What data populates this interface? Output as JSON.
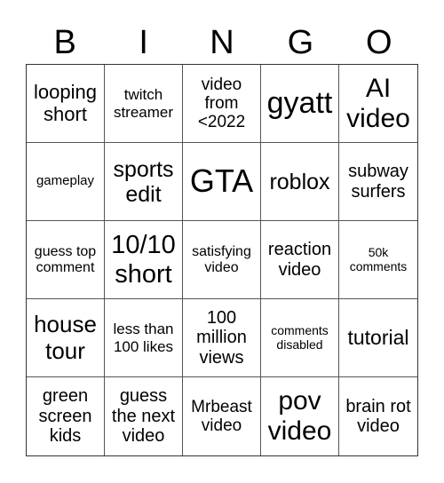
{
  "header": [
    "B",
    "I",
    "N",
    "G",
    "O"
  ],
  "cells": [
    "looping short",
    "twitch streamer",
    "video from <2022",
    "gyatt",
    "AI video",
    "gameplay",
    "sports edit",
    "GTA",
    "roblox",
    "subway surfers",
    "guess top comment",
    "10/10 short",
    "satisfying video",
    "reaction video",
    "50k comments",
    "house tour",
    "less than 100 likes",
    "100 million views",
    "comments disabled",
    "tutorial",
    "green screen kids",
    "guess the next video",
    "Mrbeast video",
    "pov video",
    "brain rot video"
  ]
}
